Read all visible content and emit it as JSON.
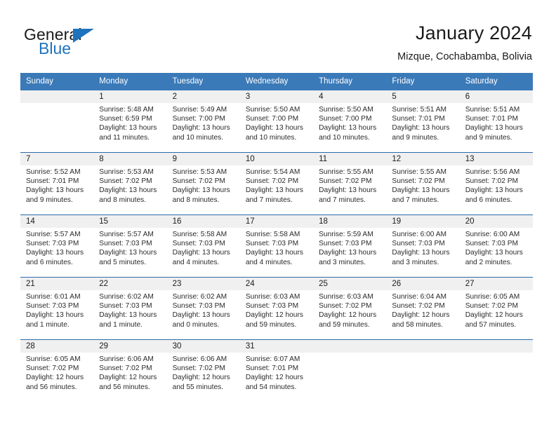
{
  "brand": {
    "name_part1": "General",
    "name_part2": "Blue",
    "accent_color": "#1f73bd",
    "triangle_icon": "triangle-icon"
  },
  "header": {
    "title": "January 2024",
    "subtitle": "Mizque, Cochabamba, Bolivia"
  },
  "theme": {
    "header_bar_color": "#3b7ab8",
    "row_divider_color": "#2b6aa8",
    "daynum_band_color": "#f0f0f0"
  },
  "calendar": {
    "weekday_headers": [
      "Sunday",
      "Monday",
      "Tuesday",
      "Wednesday",
      "Thursday",
      "Friday",
      "Saturday"
    ],
    "weeks": [
      [
        {
          "day": "",
          "sunrise": "",
          "sunset": "",
          "daylight_line1": "",
          "daylight_line2": "",
          "empty": true
        },
        {
          "day": "1",
          "sunrise": "Sunrise: 5:48 AM",
          "sunset": "Sunset: 6:59 PM",
          "daylight_line1": "Daylight: 13 hours",
          "daylight_line2": "and 11 minutes."
        },
        {
          "day": "2",
          "sunrise": "Sunrise: 5:49 AM",
          "sunset": "Sunset: 7:00 PM",
          "daylight_line1": "Daylight: 13 hours",
          "daylight_line2": "and 10 minutes."
        },
        {
          "day": "3",
          "sunrise": "Sunrise: 5:50 AM",
          "sunset": "Sunset: 7:00 PM",
          "daylight_line1": "Daylight: 13 hours",
          "daylight_line2": "and 10 minutes."
        },
        {
          "day": "4",
          "sunrise": "Sunrise: 5:50 AM",
          "sunset": "Sunset: 7:00 PM",
          "daylight_line1": "Daylight: 13 hours",
          "daylight_line2": "and 10 minutes."
        },
        {
          "day": "5",
          "sunrise": "Sunrise: 5:51 AM",
          "sunset": "Sunset: 7:01 PM",
          "daylight_line1": "Daylight: 13 hours",
          "daylight_line2": "and 9 minutes."
        },
        {
          "day": "6",
          "sunrise": "Sunrise: 5:51 AM",
          "sunset": "Sunset: 7:01 PM",
          "daylight_line1": "Daylight: 13 hours",
          "daylight_line2": "and 9 minutes."
        }
      ],
      [
        {
          "day": "7",
          "sunrise": "Sunrise: 5:52 AM",
          "sunset": "Sunset: 7:01 PM",
          "daylight_line1": "Daylight: 13 hours",
          "daylight_line2": "and 9 minutes."
        },
        {
          "day": "8",
          "sunrise": "Sunrise: 5:53 AM",
          "sunset": "Sunset: 7:02 PM",
          "daylight_line1": "Daylight: 13 hours",
          "daylight_line2": "and 8 minutes."
        },
        {
          "day": "9",
          "sunrise": "Sunrise: 5:53 AM",
          "sunset": "Sunset: 7:02 PM",
          "daylight_line1": "Daylight: 13 hours",
          "daylight_line2": "and 8 minutes."
        },
        {
          "day": "10",
          "sunrise": "Sunrise: 5:54 AM",
          "sunset": "Sunset: 7:02 PM",
          "daylight_line1": "Daylight: 13 hours",
          "daylight_line2": "and 7 minutes."
        },
        {
          "day": "11",
          "sunrise": "Sunrise: 5:55 AM",
          "sunset": "Sunset: 7:02 PM",
          "daylight_line1": "Daylight: 13 hours",
          "daylight_line2": "and 7 minutes."
        },
        {
          "day": "12",
          "sunrise": "Sunrise: 5:55 AM",
          "sunset": "Sunset: 7:02 PM",
          "daylight_line1": "Daylight: 13 hours",
          "daylight_line2": "and 7 minutes."
        },
        {
          "day": "13",
          "sunrise": "Sunrise: 5:56 AM",
          "sunset": "Sunset: 7:02 PM",
          "daylight_line1": "Daylight: 13 hours",
          "daylight_line2": "and 6 minutes."
        }
      ],
      [
        {
          "day": "14",
          "sunrise": "Sunrise: 5:57 AM",
          "sunset": "Sunset: 7:03 PM",
          "daylight_line1": "Daylight: 13 hours",
          "daylight_line2": "and 6 minutes."
        },
        {
          "day": "15",
          "sunrise": "Sunrise: 5:57 AM",
          "sunset": "Sunset: 7:03 PM",
          "daylight_line1": "Daylight: 13 hours",
          "daylight_line2": "and 5 minutes."
        },
        {
          "day": "16",
          "sunrise": "Sunrise: 5:58 AM",
          "sunset": "Sunset: 7:03 PM",
          "daylight_line1": "Daylight: 13 hours",
          "daylight_line2": "and 4 minutes."
        },
        {
          "day": "17",
          "sunrise": "Sunrise: 5:58 AM",
          "sunset": "Sunset: 7:03 PM",
          "daylight_line1": "Daylight: 13 hours",
          "daylight_line2": "and 4 minutes."
        },
        {
          "day": "18",
          "sunrise": "Sunrise: 5:59 AM",
          "sunset": "Sunset: 7:03 PM",
          "daylight_line1": "Daylight: 13 hours",
          "daylight_line2": "and 3 minutes."
        },
        {
          "day": "19",
          "sunrise": "Sunrise: 6:00 AM",
          "sunset": "Sunset: 7:03 PM",
          "daylight_line1": "Daylight: 13 hours",
          "daylight_line2": "and 3 minutes."
        },
        {
          "day": "20",
          "sunrise": "Sunrise: 6:00 AM",
          "sunset": "Sunset: 7:03 PM",
          "daylight_line1": "Daylight: 13 hours",
          "daylight_line2": "and 2 minutes."
        }
      ],
      [
        {
          "day": "21",
          "sunrise": "Sunrise: 6:01 AM",
          "sunset": "Sunset: 7:03 PM",
          "daylight_line1": "Daylight: 13 hours",
          "daylight_line2": "and 1 minute."
        },
        {
          "day": "22",
          "sunrise": "Sunrise: 6:02 AM",
          "sunset": "Sunset: 7:03 PM",
          "daylight_line1": "Daylight: 13 hours",
          "daylight_line2": "and 1 minute."
        },
        {
          "day": "23",
          "sunrise": "Sunrise: 6:02 AM",
          "sunset": "Sunset: 7:03 PM",
          "daylight_line1": "Daylight: 13 hours",
          "daylight_line2": "and 0 minutes."
        },
        {
          "day": "24",
          "sunrise": "Sunrise: 6:03 AM",
          "sunset": "Sunset: 7:03 PM",
          "daylight_line1": "Daylight: 12 hours",
          "daylight_line2": "and 59 minutes."
        },
        {
          "day": "25",
          "sunrise": "Sunrise: 6:03 AM",
          "sunset": "Sunset: 7:02 PM",
          "daylight_line1": "Daylight: 12 hours",
          "daylight_line2": "and 59 minutes."
        },
        {
          "day": "26",
          "sunrise": "Sunrise: 6:04 AM",
          "sunset": "Sunset: 7:02 PM",
          "daylight_line1": "Daylight: 12 hours",
          "daylight_line2": "and 58 minutes."
        },
        {
          "day": "27",
          "sunrise": "Sunrise: 6:05 AM",
          "sunset": "Sunset: 7:02 PM",
          "daylight_line1": "Daylight: 12 hours",
          "daylight_line2": "and 57 minutes."
        }
      ],
      [
        {
          "day": "28",
          "sunrise": "Sunrise: 6:05 AM",
          "sunset": "Sunset: 7:02 PM",
          "daylight_line1": "Daylight: 12 hours",
          "daylight_line2": "and 56 minutes."
        },
        {
          "day": "29",
          "sunrise": "Sunrise: 6:06 AM",
          "sunset": "Sunset: 7:02 PM",
          "daylight_line1": "Daylight: 12 hours",
          "daylight_line2": "and 56 minutes."
        },
        {
          "day": "30",
          "sunrise": "Sunrise: 6:06 AM",
          "sunset": "Sunset: 7:02 PM",
          "daylight_line1": "Daylight: 12 hours",
          "daylight_line2": "and 55 minutes."
        },
        {
          "day": "31",
          "sunrise": "Sunrise: 6:07 AM",
          "sunset": "Sunset: 7:01 PM",
          "daylight_line1": "Daylight: 12 hours",
          "daylight_line2": "and 54 minutes."
        },
        {
          "day": "",
          "sunrise": "",
          "sunset": "",
          "daylight_line1": "",
          "daylight_line2": "",
          "empty": true
        },
        {
          "day": "",
          "sunrise": "",
          "sunset": "",
          "daylight_line1": "",
          "daylight_line2": "",
          "empty": true
        },
        {
          "day": "",
          "sunrise": "",
          "sunset": "",
          "daylight_line1": "",
          "daylight_line2": "",
          "empty": true
        }
      ]
    ]
  }
}
